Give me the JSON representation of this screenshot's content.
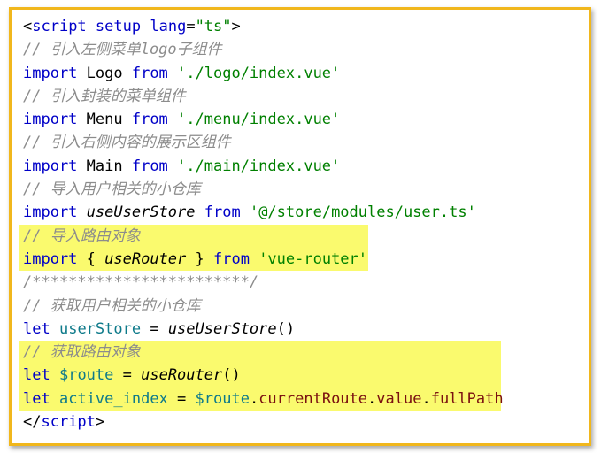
{
  "lines": [
    {
      "id": "l1",
      "tokens": [
        {
          "t": "<",
          "c": "plain"
        },
        {
          "t": "script",
          "c": "tag"
        },
        {
          "t": " ",
          "c": "plain"
        },
        {
          "t": "setup",
          "c": "attr"
        },
        {
          "t": " ",
          "c": "plain"
        },
        {
          "t": "lang",
          "c": "attr"
        },
        {
          "t": "=",
          "c": "plain"
        },
        {
          "t": "\"ts\"",
          "c": "str"
        },
        {
          "t": ">",
          "c": "plain"
        }
      ]
    },
    {
      "id": "l2",
      "tokens": [
        {
          "t": "// 引入左侧菜单logo子组件",
          "c": "com"
        }
      ]
    },
    {
      "id": "l3",
      "tokens": [
        {
          "t": "import",
          "c": "kw"
        },
        {
          "t": " Logo ",
          "c": "plain"
        },
        {
          "t": "from",
          "c": "kw"
        },
        {
          "t": " ",
          "c": "plain"
        },
        {
          "t": "'./logo/index.vue'",
          "c": "str"
        }
      ]
    },
    {
      "id": "l4",
      "tokens": [
        {
          "t": "// 引入封装的菜单组件",
          "c": "com"
        }
      ]
    },
    {
      "id": "l5",
      "tokens": [
        {
          "t": "import",
          "c": "kw"
        },
        {
          "t": " Menu ",
          "c": "plain"
        },
        {
          "t": "from",
          "c": "kw"
        },
        {
          "t": " ",
          "c": "plain"
        },
        {
          "t": "'./menu/index.vue'",
          "c": "str"
        }
      ]
    },
    {
      "id": "l6",
      "tokens": [
        {
          "t": "// 引入右侧内容的展示区组件",
          "c": "com"
        }
      ]
    },
    {
      "id": "l7",
      "tokens": [
        {
          "t": "import",
          "c": "kw"
        },
        {
          "t": " Main ",
          "c": "plain"
        },
        {
          "t": "from",
          "c": "kw"
        },
        {
          "t": " ",
          "c": "plain"
        },
        {
          "t": "'./main/index.vue'",
          "c": "str"
        }
      ]
    },
    {
      "id": "l8",
      "tokens": [
        {
          "t": "// 导入用户相关的小仓库",
          "c": "com"
        }
      ]
    },
    {
      "id": "l9",
      "tokens": [
        {
          "t": "import",
          "c": "kw"
        },
        {
          "t": " ",
          "c": "plain"
        },
        {
          "t": "useUserStore",
          "c": "fn"
        },
        {
          "t": " ",
          "c": "plain"
        },
        {
          "t": "from",
          "c": "kw"
        },
        {
          "t": " ",
          "c": "plain"
        },
        {
          "t": "'@/store/modules/user.ts'",
          "c": "str"
        }
      ]
    },
    {
      "id": "l10",
      "hl": 1,
      "tokens": [
        {
          "t": "// 导入路由对象",
          "c": "com"
        }
      ]
    },
    {
      "id": "l11",
      "hl": 1,
      "tokens": [
        {
          "t": "import",
          "c": "kw"
        },
        {
          "t": " { ",
          "c": "plain"
        },
        {
          "t": "useRouter",
          "c": "fn"
        },
        {
          "t": " } ",
          "c": "plain"
        },
        {
          "t": "from",
          "c": "kw"
        },
        {
          "t": " ",
          "c": "plain"
        },
        {
          "t": "'vue-router'",
          "c": "str"
        }
      ]
    },
    {
      "id": "l12",
      "tokens": [
        {
          "t": "/************************/",
          "c": "com"
        }
      ]
    },
    {
      "id": "l13",
      "tokens": [
        {
          "t": "// 获取用户相关的小仓库",
          "c": "com"
        }
      ]
    },
    {
      "id": "l14",
      "tokens": [
        {
          "t": "let",
          "c": "kw"
        },
        {
          "t": " ",
          "c": "plain"
        },
        {
          "t": "userStore",
          "c": "var"
        },
        {
          "t": " = ",
          "c": "plain"
        },
        {
          "t": "useUserStore",
          "c": "fn"
        },
        {
          "t": "()",
          "c": "plain"
        }
      ]
    },
    {
      "id": "l15",
      "hl": 2,
      "tokens": [
        {
          "t": "// 获取路由对象",
          "c": "com"
        }
      ]
    },
    {
      "id": "l16",
      "hl": 2,
      "tokens": [
        {
          "t": "let",
          "c": "kw"
        },
        {
          "t": " ",
          "c": "plain"
        },
        {
          "t": "$route",
          "c": "var"
        },
        {
          "t": " = ",
          "c": "plain"
        },
        {
          "t": "useRouter",
          "c": "fn"
        },
        {
          "t": "()",
          "c": "plain"
        }
      ]
    },
    {
      "id": "l17",
      "hl": 2,
      "tokens": [
        {
          "t": "let",
          "c": "kw"
        },
        {
          "t": " ",
          "c": "plain"
        },
        {
          "t": "active_index",
          "c": "var"
        },
        {
          "t": " = ",
          "c": "plain"
        },
        {
          "t": "$route",
          "c": "var"
        },
        {
          "t": ".",
          "c": "plain"
        },
        {
          "t": "currentRoute",
          "c": "prop"
        },
        {
          "t": ".",
          "c": "plain"
        },
        {
          "t": "value",
          "c": "prop"
        },
        {
          "t": ".",
          "c": "plain"
        },
        {
          "t": "fullPath",
          "c": "prop"
        }
      ]
    },
    {
      "id": "l18",
      "tokens": [
        {
          "t": "</",
          "c": "plain"
        },
        {
          "t": "script",
          "c": "tag"
        },
        {
          "t": ">",
          "c": "plain"
        }
      ]
    }
  ],
  "highlight_color": "#fafa6e",
  "frame_color": "#f1b71c"
}
